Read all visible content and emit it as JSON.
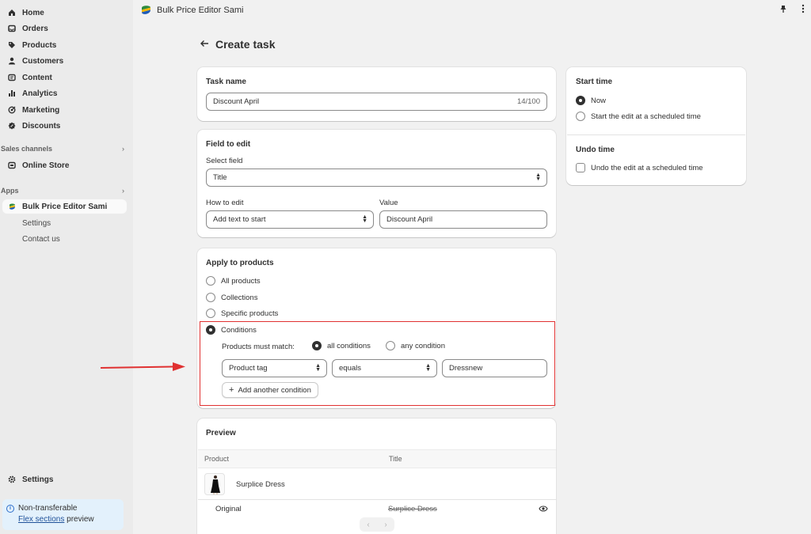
{
  "sidebar": {
    "items": [
      {
        "label": "Home",
        "icon": "home-icon"
      },
      {
        "label": "Orders",
        "icon": "orders-icon"
      },
      {
        "label": "Products",
        "icon": "tag-icon"
      },
      {
        "label": "Customers",
        "icon": "person-icon"
      },
      {
        "label": "Content",
        "icon": "content-icon"
      },
      {
        "label": "Analytics",
        "icon": "bar-chart-icon"
      },
      {
        "label": "Marketing",
        "icon": "target-icon"
      },
      {
        "label": "Discounts",
        "icon": "discount-icon"
      }
    ],
    "sales_channels_label": "Sales channels",
    "online_store": "Online Store",
    "apps_label": "Apps",
    "app_name": "Bulk Price Editor Sami",
    "app_sub": [
      "Settings",
      "Contact us"
    ],
    "settings": "Settings",
    "notice": {
      "line1": "Non-transferable",
      "link": "Flex sections",
      "line2_rest": " preview"
    }
  },
  "topbar": {
    "title": "Bulk Price Editor Sami"
  },
  "page": {
    "title": "Create task"
  },
  "task_name": {
    "title": "Task name",
    "value": "Discount April",
    "counter": "14/100"
  },
  "field_to_edit": {
    "title": "Field to edit",
    "select_label": "Select field",
    "select_value": "Title",
    "how_label": "How to edit",
    "how_value": "Add text to start",
    "value_label": "Value",
    "value_value": "Discount April"
  },
  "apply": {
    "title": "Apply to products",
    "options": [
      "All products",
      "Collections",
      "Specific products",
      "Conditions"
    ],
    "selected": "Conditions",
    "must_match_label": "Products must match:",
    "match_options": [
      "all conditions",
      "any condition"
    ],
    "condition": {
      "field": "Product tag",
      "operator": "equals",
      "value": "Dressnew"
    },
    "add_condition": "Add another condition"
  },
  "preview": {
    "title": "Preview",
    "columns": [
      "Product",
      "Title"
    ],
    "product_name": "Surplice Dress",
    "row_label": "Original",
    "row_value": "Surplice Dress"
  },
  "start_time": {
    "title": "Start time",
    "options": [
      "Now",
      "Start the edit at a scheduled time"
    ],
    "selected": "Now"
  },
  "undo_time": {
    "title": "Undo time",
    "checkbox": "Undo the edit at a scheduled time"
  },
  "colors": {
    "highlight": "#e03131",
    "arrow": "#e03131",
    "notice_bg": "#e3f1fc"
  }
}
